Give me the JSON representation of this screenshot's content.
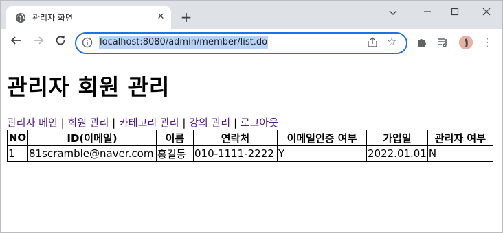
{
  "browser": {
    "tab_title": "관리자 화면",
    "url": "localhost:8080/admin/member/list.do"
  },
  "page": {
    "heading": "관리자 회원 관리",
    "nav_links": [
      "관리자 메인",
      "회원 관리",
      "카테고리 관리",
      "강의 관리",
      "로그아웃"
    ],
    "separator": "|"
  },
  "table": {
    "headers": [
      "NO",
      "ID(이메일)",
      "이름",
      "연락처",
      "이메일인증 여부",
      "가입일",
      "관리자 여부"
    ],
    "rows": [
      [
        "1",
        "81scramble@naver.com",
        "홍길동",
        "010-1111-2222",
        "Y",
        "2022.01.01",
        "N"
      ]
    ]
  },
  "colors": {
    "visited_link": "#551a8b",
    "focus_ring": "#1a73e8",
    "url_selection": "#b8d3f7"
  }
}
